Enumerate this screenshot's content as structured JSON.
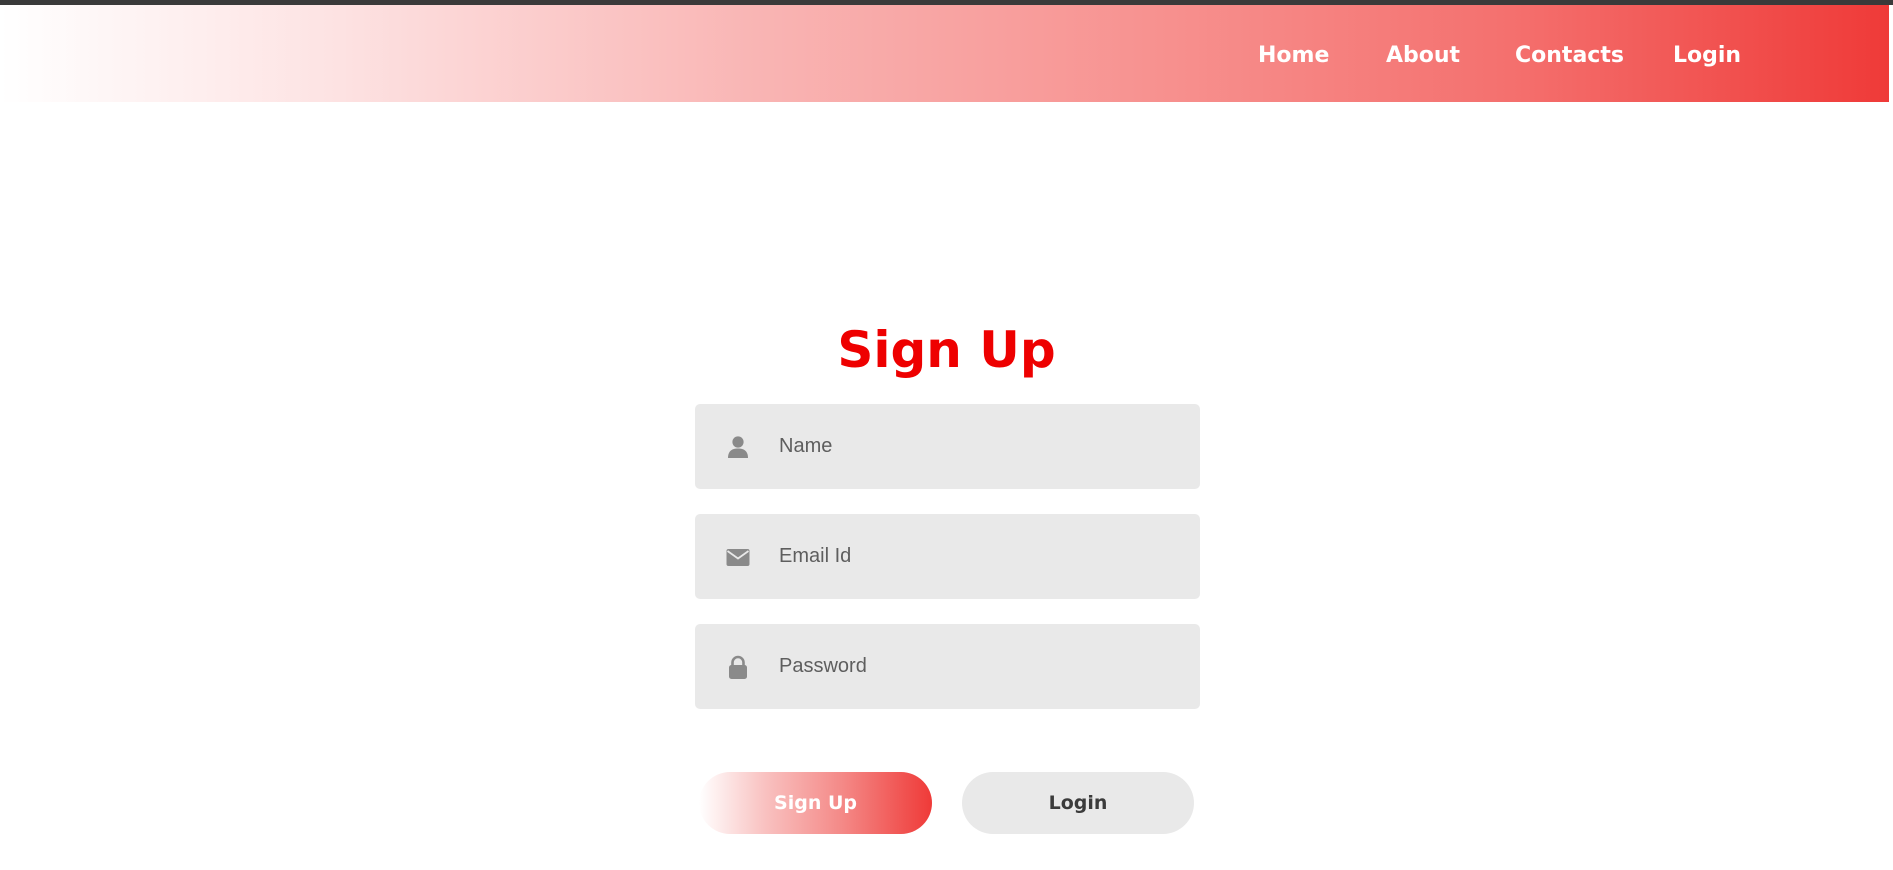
{
  "nav": {
    "items": [
      "Home",
      "About",
      "Contacts",
      "Login"
    ]
  },
  "form": {
    "title": "Sign Up",
    "name_placeholder": "Name",
    "email_placeholder": "Email Id",
    "password_placeholder": "Password",
    "signup_label": "Sign Up",
    "login_label": "Login"
  },
  "icons": {
    "name": "user-icon",
    "email": "envelope-icon",
    "password": "lock-icon"
  },
  "colors": {
    "accent": "#ef3a38",
    "title": "#ee0000",
    "field_bg": "#e9e9e9",
    "icon": "#8a8a8a"
  }
}
